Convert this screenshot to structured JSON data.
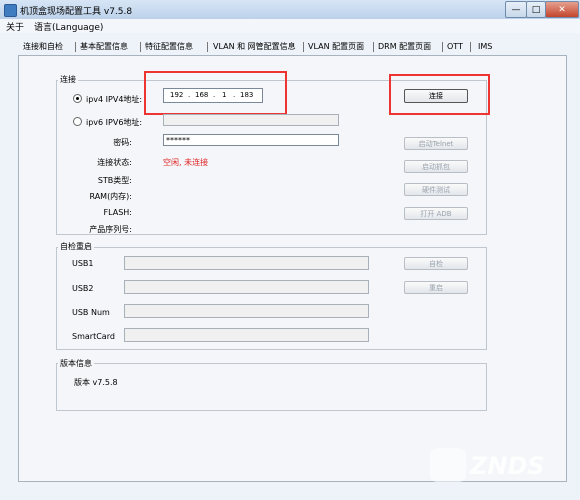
{
  "window": {
    "title": "机顶盒现场配置工具 v7.5.8",
    "min_label": "—",
    "max_label": "□",
    "close_label": "✕"
  },
  "menu": [
    "关于",
    "语言(Language)"
  ],
  "tabs": [
    "连接和自检",
    "基本配置信息",
    "特征配置信息",
    "VLAN 和 网管配置信息",
    "VLAN 配置页面",
    "DRM 配置页面",
    "OTT",
    "IMS"
  ],
  "connect": {
    "legend": "连接",
    "ipv4_label": "ipv4  IPV4地址:",
    "ip": [
      "192",
      "168",
      "1",
      "183"
    ],
    "ip_dot": ".",
    "ipv6_label": "ipv6  IPV6地址:",
    "password_label": "密码:",
    "password_value": "******",
    "status_label": "连接状态:",
    "status_value": "空闲, 未连接",
    "stb_label": "STB类型:",
    "ram_label": "RAM(内存):",
    "flash_label": "FLASH:",
    "serial_label": "产品序列号:",
    "connect_button": "连接",
    "telnet_button": "启动Telnet",
    "capture_button": "启动抓包",
    "hwtest_button": "硬件测试",
    "adb_button": "打开 ADB"
  },
  "selfcheck": {
    "legend": "自检重启",
    "usb1_label": "USB1",
    "usb2_label": "USB2",
    "usbnum_label": "USB Num",
    "smartcard_label": "SmartCard",
    "check_button": "自检",
    "restart_button": "重启"
  },
  "version": {
    "legend": "版本信息",
    "text": "版本  v7.5.8"
  },
  "watermark": "ZNDS"
}
